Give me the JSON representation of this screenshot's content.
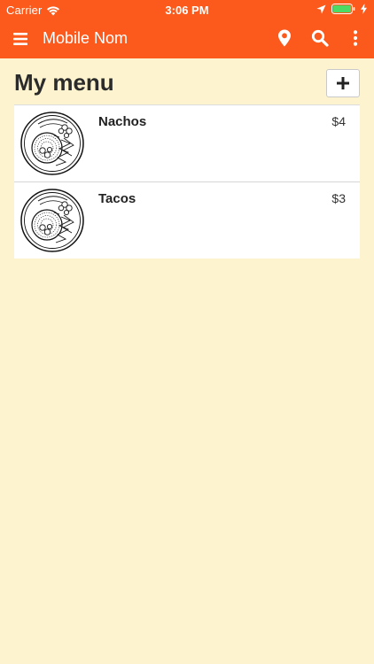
{
  "status_bar": {
    "carrier": "Carrier",
    "time": "3:06 PM"
  },
  "nav": {
    "title": "Mobile Nom",
    "icons": [
      "hamburger-menu-icon",
      "location-pin-icon",
      "search-icon",
      "more-vertical-icon"
    ]
  },
  "page": {
    "title": "My menu",
    "add_label": "+"
  },
  "menu": {
    "items": [
      {
        "name": "Nachos",
        "price": "$4"
      },
      {
        "name": "Tacos",
        "price": "$3"
      }
    ]
  },
  "colors": {
    "header": "#fb5a1c",
    "background": "#fdf4cf",
    "card": "#ffffff"
  }
}
